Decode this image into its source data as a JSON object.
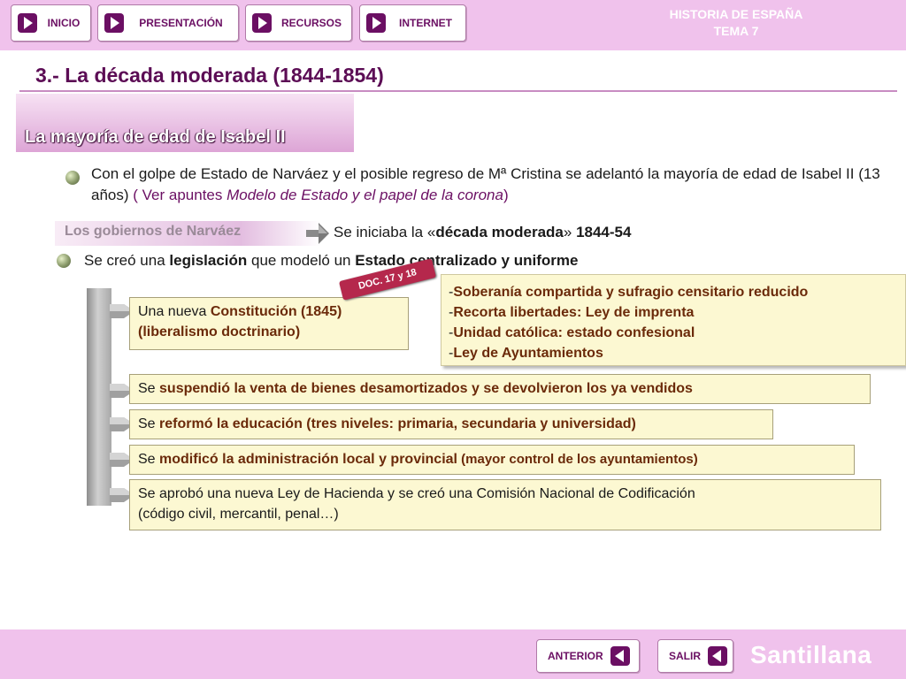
{
  "nav": {
    "inicio": "INICIO",
    "presentacion": "PRESENTACIÓN",
    "recursos": "RECURSOS",
    "internet": "INTERNET"
  },
  "subject": {
    "line1": "HISTORIA DE ESPAÑA",
    "line2": "TEMA 7"
  },
  "title": "3.- La década moderada (1844-1854)",
  "section_heading": "La mayoría de edad de Isabel II",
  "para1": {
    "text": "Con el golpe de Estado de Narváez y el posible regreso de Mª Cristina se adelantó la mayoría de edad de Isabel II (13 años)",
    "note_open": " ( Ver apuntes ",
    "note_italic": "Modelo de Estado y el papel de la corona",
    "note_close": ")"
  },
  "gobiernos_label": "Los gobiernos de Narváez",
  "para2": {
    "pre": "Se iniciaba la «",
    "bold": "década moderada",
    "mid": "» ",
    "years": "1844-54"
  },
  "para3": {
    "pre": "Se creó una ",
    "bold1": "legislación",
    "mid": " que modeló un ",
    "bold2": "Estado centralizado y uniforme"
  },
  "doc_tag": "DOC. 17 y 18",
  "constitution_box": {
    "pre": "Una nueva ",
    "bold": "Constitución (1845)",
    "line2": "(liberalismo doctrinario)"
  },
  "doc_items": [
    "Soberanía compartida y sufragio censitario reducido",
    "Recorta libertades: Ley de imprenta",
    "Unidad católica: estado confesional",
    "Ley de Ayuntamientos"
  ],
  "box_desamort": {
    "pre": "Se ",
    "bold": "suspendió la venta de bienes desamortizados y se devolvieron los ya vendidos"
  },
  "box_educacion": {
    "pre": "Se ",
    "bold": "reformó la educación (tres niveles: primaria, secundaria y universidad)"
  },
  "box_admin": {
    "pre": "Se ",
    "bold": "modificó la administración local y provincial",
    "small": " (mayor control de los ayuntamientos)"
  },
  "box_hacienda": {
    "line1": "Se aprobó una nueva Ley de Hacienda y se creó una Comisión Nacional de Codificación",
    "line2": "(código civil, mercantil, penal…)"
  },
  "bottom": {
    "anterior": "ANTERIOR",
    "salir": "SALIR",
    "brand": "Santillana"
  },
  "colors": {
    "bar": "#f0c2ec",
    "title": "#5c0d55",
    "box_bg": "#fcf8d2",
    "doc_tag": "#b5284c"
  }
}
